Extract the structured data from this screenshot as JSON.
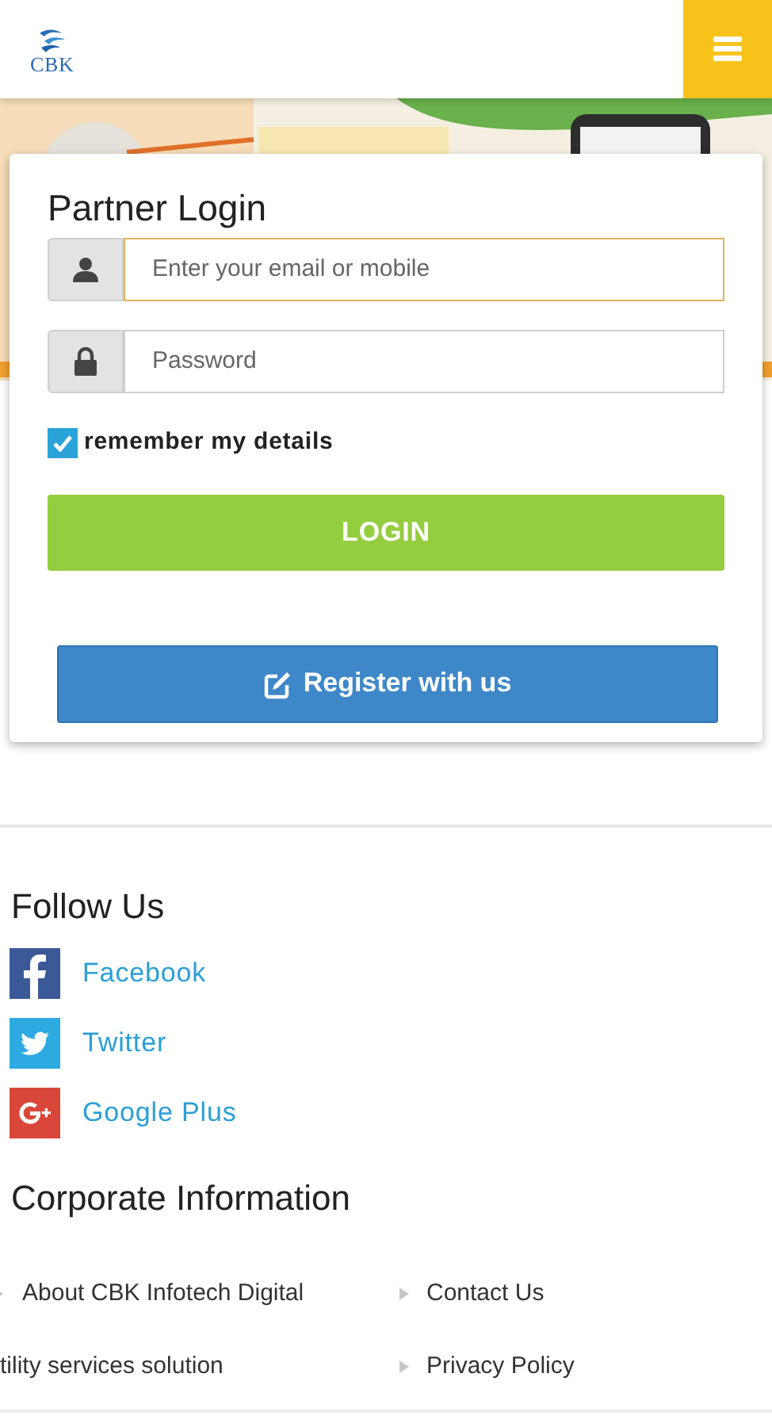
{
  "header": {
    "logo_text": "CBK"
  },
  "login": {
    "title": "Partner Login",
    "fields": [
      {
        "kind": "user",
        "placeholder": "Enter your email or mobile",
        "focused": true
      },
      {
        "kind": "lock",
        "placeholder": "Password",
        "focused": false
      }
    ],
    "remember": {
      "label": "remember my details",
      "checked": true
    },
    "login_button": "LOGIN",
    "register_button": "Register with us"
  },
  "follow": {
    "title": "Follow Us",
    "links": [
      {
        "kind": "facebook",
        "label": "Facebook"
      },
      {
        "kind": "twitter",
        "label": "Twitter"
      },
      {
        "kind": "googleplus",
        "label": "Google Plus"
      }
    ]
  },
  "corporate": {
    "title": "Corporate Information",
    "links": [
      {
        "label": "About CBK Infotech Digital",
        "kind": "cut"
      },
      {
        "label": "Contact Us",
        "kind": "bulleted"
      },
      {
        "label": "tility services solution",
        "kind": "plain"
      },
      {
        "label": "Privacy Policy",
        "kind": "bulleted"
      }
    ]
  }
}
